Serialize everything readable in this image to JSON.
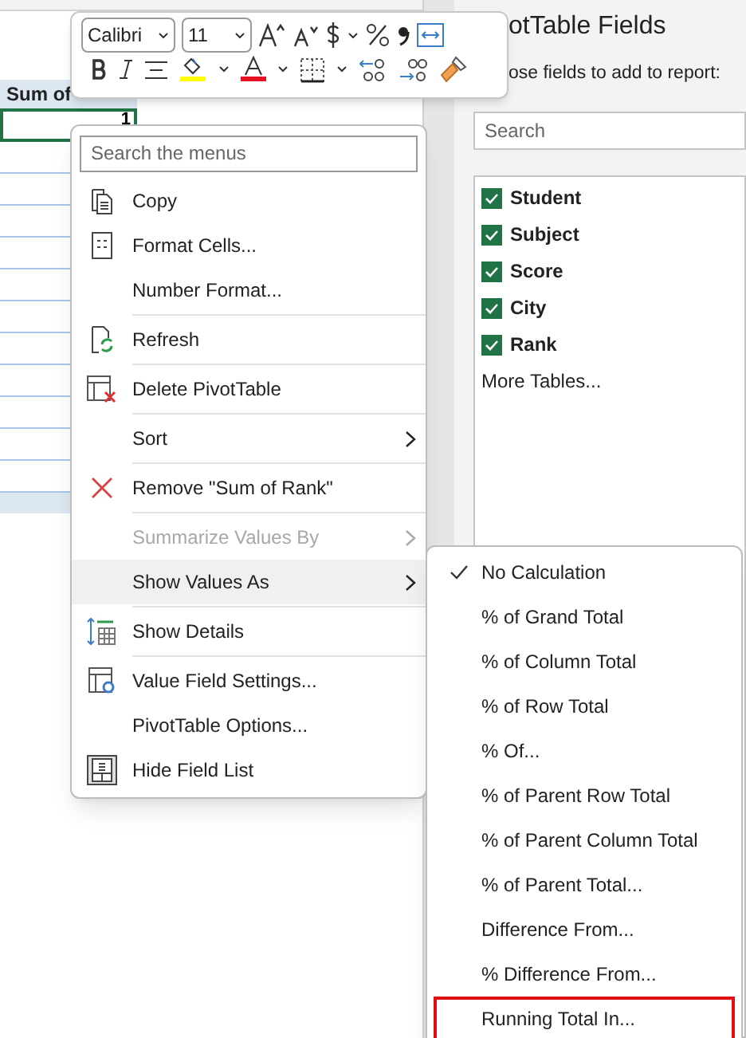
{
  "sheet": {
    "header_cell": "Sum of",
    "value_cell": "1"
  },
  "mini_toolbar": {
    "font": "Calibri",
    "size": "11"
  },
  "field_pane": {
    "title": "otTable Fields",
    "subtitle": "ose fields to add to report:",
    "search": {
      "placeholder": "Search"
    },
    "fields": [
      {
        "label": "Student",
        "checked": true
      },
      {
        "label": "Subject",
        "checked": true
      },
      {
        "label": "Score",
        "checked": true
      },
      {
        "label": "City",
        "checked": true
      },
      {
        "label": "Rank",
        "checked": true
      }
    ],
    "more_link": "More Tables..."
  },
  "context_menu": {
    "search": {
      "placeholder": "Search the menus"
    },
    "items": [
      {
        "label": "Copy",
        "divider_after": false,
        "submenu": false,
        "disabled": false,
        "highlighted": false
      },
      {
        "label": "Format Cells...",
        "divider_after": false,
        "submenu": false,
        "disabled": false,
        "highlighted": false
      },
      {
        "label": "Number Format...",
        "divider_after": true,
        "submenu": false,
        "disabled": false,
        "highlighted": false
      },
      {
        "label": "Refresh",
        "divider_after": true,
        "submenu": false,
        "disabled": false,
        "highlighted": false
      },
      {
        "label": "Delete PivotTable",
        "divider_after": true,
        "submenu": false,
        "disabled": false,
        "highlighted": false
      },
      {
        "label": "Sort",
        "divider_after": true,
        "submenu": true,
        "disabled": false,
        "highlighted": false
      },
      {
        "label": "Remove \"Sum of Rank\"",
        "divider_after": true,
        "submenu": false,
        "disabled": false,
        "highlighted": false
      },
      {
        "label": "Summarize Values By",
        "divider_after": false,
        "submenu": true,
        "disabled": true,
        "highlighted": false
      },
      {
        "label": "Show Values As",
        "divider_after": true,
        "submenu": true,
        "disabled": false,
        "highlighted": true
      },
      {
        "label": "Show Details",
        "divider_after": true,
        "submenu": false,
        "disabled": false,
        "highlighted": false
      },
      {
        "label": "Value Field Settings...",
        "divider_after": false,
        "submenu": false,
        "disabled": false,
        "highlighted": false
      },
      {
        "label": "PivotTable Options...",
        "divider_after": false,
        "submenu": false,
        "disabled": false,
        "highlighted": false
      },
      {
        "label": "Hide Field List",
        "divider_after": false,
        "submenu": false,
        "disabled": false,
        "highlighted": false
      }
    ]
  },
  "submenu": {
    "items": [
      {
        "label": "No Calculation",
        "checked": true,
        "outlined": false
      },
      {
        "label": "% of Grand Total",
        "checked": false,
        "outlined": false
      },
      {
        "label": "% of Column Total",
        "checked": false,
        "outlined": false
      },
      {
        "label": "% of Row Total",
        "checked": false,
        "outlined": false
      },
      {
        "label": "% Of...",
        "checked": false,
        "outlined": false
      },
      {
        "label": "% of Parent Row Total",
        "checked": false,
        "outlined": false
      },
      {
        "label": "% of Parent Column Total",
        "checked": false,
        "outlined": false
      },
      {
        "label": "% of Parent Total...",
        "checked": false,
        "outlined": false
      },
      {
        "label": "Difference From...",
        "checked": false,
        "outlined": false
      },
      {
        "label": "% Difference From...",
        "checked": false,
        "outlined": false
      },
      {
        "label": "Running Total In...",
        "checked": false,
        "outlined": true
      }
    ]
  }
}
